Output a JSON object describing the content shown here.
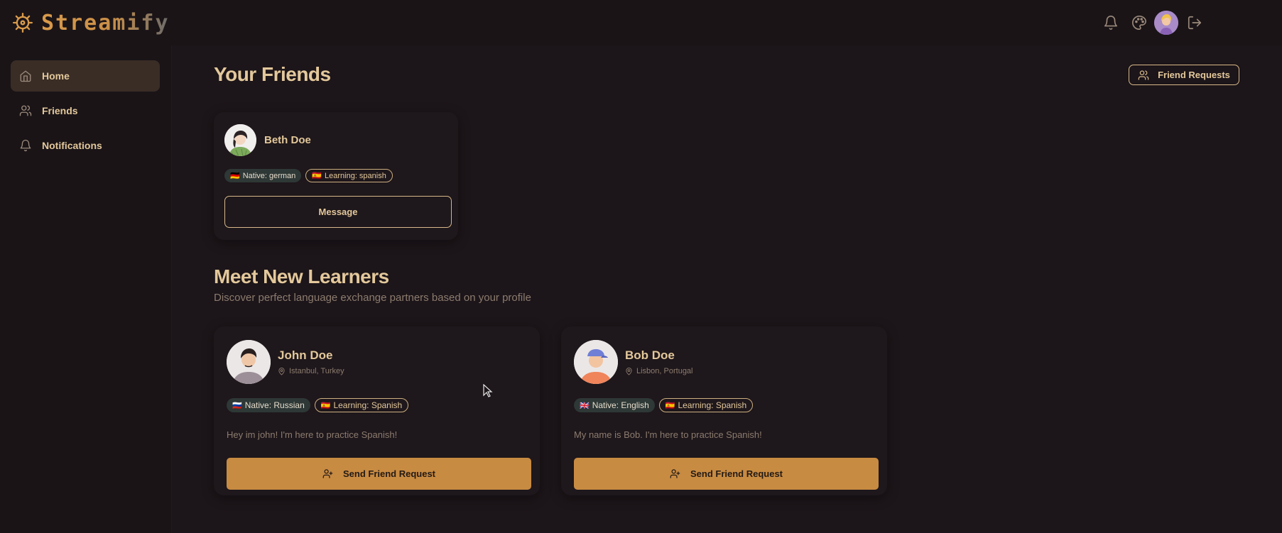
{
  "app": {
    "name": "Streamify"
  },
  "nav": {
    "items": [
      {
        "label": "Home",
        "icon": "home-icon",
        "active": true
      },
      {
        "label": "Friends",
        "icon": "users-icon",
        "active": false
      },
      {
        "label": "Notifications",
        "icon": "bell-icon",
        "active": false
      }
    ]
  },
  "header": {
    "friend_requests_label": "Friend Requests"
  },
  "friends_section": {
    "title": "Your Friends",
    "friends": [
      {
        "name": "Beth Doe",
        "native": "Native: german",
        "native_flag": "🇩🇪",
        "learning": "Learning: spanish",
        "learning_flag": "🇪🇸",
        "message_label": "Message"
      }
    ]
  },
  "learners_section": {
    "title": "Meet New Learners",
    "subtitle": "Discover perfect language exchange partners based on your profile",
    "learners": [
      {
        "name": "John Doe",
        "location": "Istanbul, Turkey",
        "native": "Native: Russian",
        "native_flag": "🇷🇺",
        "learning": "Learning: Spanish",
        "learning_flag": "🇪🇸",
        "bio": "Hey im john! I'm here to practice Spanish!",
        "action_label": "Send Friend Request"
      },
      {
        "name": "Bob Doe",
        "location": "Lisbon, Portugal",
        "native": "Native: English",
        "native_flag": "🇬🇧",
        "learning": "Learning: Spanish",
        "learning_flag": "🇪🇸",
        "bio": "My name is Bob. I'm here to practice Spanish!",
        "action_label": "Send Friend Request"
      }
    ]
  },
  "colors": {
    "background": "#1c1519",
    "accent": "#c88b42",
    "text": "#e3c89b",
    "muted": "#8c7c6f"
  }
}
